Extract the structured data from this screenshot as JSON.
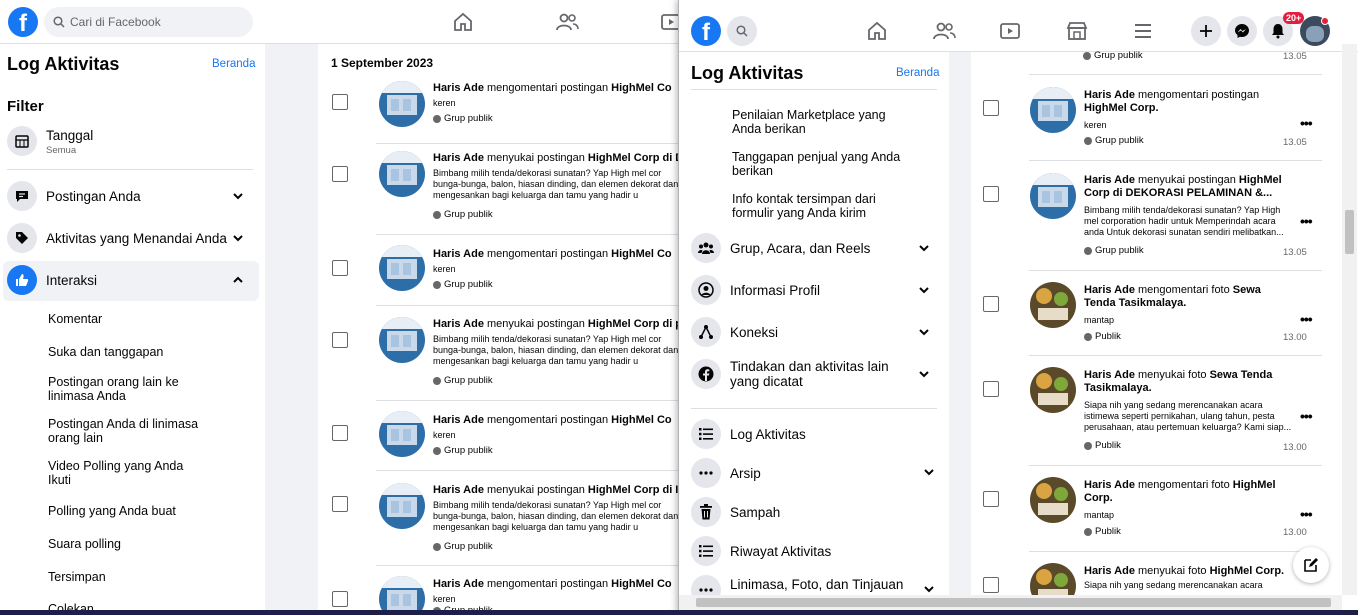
{
  "left_window": {
    "search_placeholder": "Cari di Facebook",
    "page_title": "Log Aktivitas",
    "home_link": "Beranda",
    "filter_heading": "Filter",
    "date_filter": {
      "label": "Tanggal",
      "value": "Semua"
    },
    "categories": [
      {
        "label": "Postingan Anda"
      },
      {
        "label": "Aktivitas yang Menandai Anda"
      },
      {
        "label": "Interaksi"
      }
    ],
    "interaction_subitems": [
      "Komentar",
      "Suka dan tanggapan",
      "Postingan orang lain ke linimasa Anda",
      "Postingan Anda di linimasa orang lain",
      "Video Polling yang Anda Ikuti",
      "Polling yang Anda buat",
      "Suara polling",
      "Tersimpan",
      "Colekan"
    ],
    "date_header": "1 September 2023",
    "feed": [
      {
        "actor": "Haris Ade",
        "verb": "mengomentari postingan",
        "target": "HighMel Co",
        "body": "keren",
        "audience": "Grup publik"
      },
      {
        "actor": "Haris Ade",
        "verb": "menyukai postingan",
        "target": "HighMel Corp di D",
        "body": "Bimbang milih tenda/dekorasi sunatan? Yap High mel cor bunga-bunga, balon, hiasan dinding, dan elemen dekorat dan mengesankan bagi keluarga dan tamu yang hadir u",
        "audience": "Grup publik"
      },
      {
        "actor": "Haris Ade",
        "verb": "mengomentari postingan",
        "target": "HighMel Co",
        "body": "keren",
        "audience": "Grup publik"
      },
      {
        "actor": "Haris Ade",
        "verb": "menyukai postingan",
        "target": "HighMel Corp di p",
        "body": "Bimbang milih tenda/dekorasi sunatan? Yap High mel cor bunga-bunga, balon, hiasan dinding, dan elemen dekorat dan mengesankan bagi keluarga dan tamu yang hadir u",
        "audience": "Grup publik"
      },
      {
        "actor": "Haris Ade",
        "verb": "mengomentari postingan",
        "target": "HighMel Co",
        "body": "keren",
        "audience": "Grup publik"
      },
      {
        "actor": "Haris Ade",
        "verb": "menyukai postingan",
        "target": "HighMel Corp di I",
        "body": "Bimbang milih tenda/dekorasi sunatan? Yap High mel cor bunga-bunga, balon, hiasan dinding, dan elemen dekorat dan mengesankan bagi keluarga dan tamu yang hadir u",
        "audience": "Grup publik"
      },
      {
        "actor": "Haris Ade",
        "verb": "mengomentari postingan",
        "target": "HighMel Co",
        "body": "keren",
        "audience": "Grup publik"
      }
    ]
  },
  "right_window": {
    "page_title": "Log Aktivitas",
    "home_link": "Beranda",
    "notification_badge": "20+",
    "sub_links": [
      "Penilaian Marketplace yang Anda berikan",
      "Tanggapan penjual yang Anda berikan",
      "Info kontak tersimpan dari formulir yang Anda kirim"
    ],
    "categories": [
      "Grup, Acara, dan Reels",
      "Informasi Profil",
      "Koneksi",
      "Tindakan dan aktivitas lain yang dicatat"
    ],
    "tools": [
      "Log Aktivitas",
      "Arsip",
      "Sampah",
      "Riwayat Aktivitas",
      "Linimasa, Foto, dan Tinjauan"
    ],
    "top_partial": {
      "audience": "Grup publik",
      "time": "13.05"
    },
    "feed": [
      {
        "actor": "Haris Ade",
        "verb": "mengomentari postingan",
        "target": "HighMel Corp.",
        "body": "keren",
        "audience": "Grup publik",
        "time": "13.05"
      },
      {
        "actor": "Haris Ade",
        "verb": "menyukai postingan",
        "target": "HighMel Corp di DEKORASI PELAMINAN &...",
        "body": "Bimbang milih tenda/dekorasi sunatan? Yap High mel corporation hadir untuk Memperindah acara anda Untuk dekorasi sunatan sendiri melibatkan...",
        "audience": "Grup publik",
        "time": "13.05"
      },
      {
        "actor": "Haris Ade",
        "verb": "mengomentari foto",
        "target": "Sewa Tenda Tasikmalaya.",
        "body": "mantap",
        "audience": "Publik",
        "time": "13.00"
      },
      {
        "actor": "Haris Ade",
        "verb": "menyukai foto",
        "target": "Sewa Tenda Tasikmalaya.",
        "body": "Siapa nih yang sedang merencanakan acara istimewa seperti pernikahan, ulang tahun, pesta perusahaan, atau pertemuan keluarga? Kami siap...",
        "audience": "Publik",
        "time": "13.00"
      },
      {
        "actor": "Haris Ade",
        "verb": "mengomentari foto",
        "target": "HighMel Corp.",
        "body": "mantap",
        "audience": "Publik",
        "time": "13.00"
      },
      {
        "actor": "Haris Ade",
        "verb": "menyukai foto",
        "target": "HighMel Corp.",
        "body": "Siapa nih yang sedang merencanakan acara",
        "audience": "",
        "time": ""
      }
    ]
  }
}
